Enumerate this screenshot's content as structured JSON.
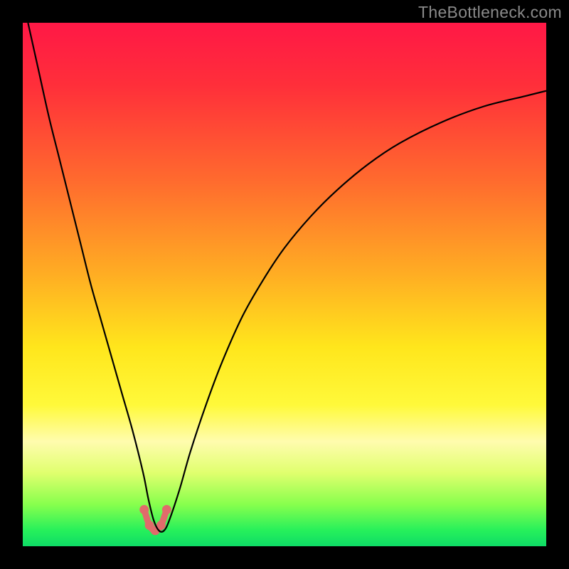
{
  "watermark": "TheBottleneck.com",
  "chart_data": {
    "type": "line",
    "title": "",
    "xlabel": "",
    "ylabel": "",
    "xlim": [
      0,
      100
    ],
    "ylim": [
      0,
      100
    ],
    "gradient_stops": [
      {
        "offset": 0,
        "color": "#ff1846"
      },
      {
        "offset": 0.12,
        "color": "#ff2f3a"
      },
      {
        "offset": 0.3,
        "color": "#ff6a2e"
      },
      {
        "offset": 0.48,
        "color": "#ffad23"
      },
      {
        "offset": 0.62,
        "color": "#ffe61c"
      },
      {
        "offset": 0.73,
        "color": "#fff93a"
      },
      {
        "offset": 0.8,
        "color": "#fffcae"
      },
      {
        "offset": 0.86,
        "color": "#e0ff6e"
      },
      {
        "offset": 0.92,
        "color": "#88ff4d"
      },
      {
        "offset": 0.97,
        "color": "#26f05b"
      },
      {
        "offset": 1.0,
        "color": "#0edc66"
      }
    ],
    "series": [
      {
        "name": "bottleneck-curve",
        "color": "#000000",
        "x": [
          1,
          3,
          5,
          7,
          9,
          11,
          13,
          15,
          17,
          19,
          21,
          23,
          24,
          25,
          26,
          27,
          28,
          30,
          32,
          35,
          38,
          42,
          46,
          50,
          55,
          60,
          66,
          72,
          80,
          88,
          96,
          100
        ],
        "y": [
          100,
          91,
          82,
          74,
          66,
          58,
          50,
          43,
          36,
          29,
          22,
          14,
          9,
          5,
          3,
          3,
          5,
          11,
          18,
          27,
          35,
          44,
          51,
          57,
          63,
          68,
          73,
          77,
          81,
          84,
          86,
          87
        ]
      }
    ],
    "marker_points": {
      "color": "#e16b6b",
      "stroke_width": 9,
      "x": [
        23.2,
        24.2,
        25.3,
        26.4,
        27.5
      ],
      "y": [
        7.0,
        4.0,
        3.0,
        4.0,
        7.0
      ]
    }
  }
}
